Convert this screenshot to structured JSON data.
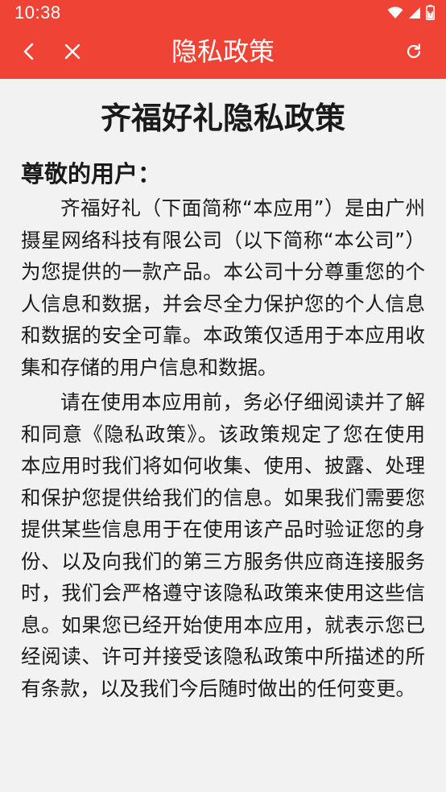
{
  "status_bar": {
    "time": "10:38",
    "icons": [
      "wifi-icon",
      "signal-icon",
      "battery-icon"
    ]
  },
  "toolbar": {
    "title": "隐私政策",
    "back_icon": "chevron-left-icon",
    "close_icon": "close-icon",
    "refresh_icon": "refresh-icon"
  },
  "colors": {
    "accent": "#ef4336",
    "background": "#f2f2f2",
    "text": "#1a1a1a"
  },
  "document": {
    "title": "齐福好礼隐私政策",
    "greeting": "尊敬的用户：",
    "paragraphs": [
      "齐福好礼（下面简称“本应用”）是由广州摄星网络科技有限公司（以下简称“本公司”）为您提供的一款产品。本公司十分尊重您的个人信息和数据，并会尽全力保护您的个人信息和数据的安全可靠。本政策仅适用于本应用收集和存储的用户信息和数据。",
      "请在使用本应用前，务必仔细阅读并了解和同意《隐私政策》。该政策规定了您在使用本应用时我们将如何收集、使用、披露、处理和保护您提供给我们的信息。如果我们需要您提供某些信息用于在使用该产品时验证您的身份、以及向我们的第三方服务供应商连接服务时，我们会严格遵守该隐私政策来使用这些信息。如果您已经开始使用本应用，就表示您已经阅读、许可并接受该隐私政策中所描述的所有条款，以及我们今后随时做出的任何变更。"
    ]
  }
}
